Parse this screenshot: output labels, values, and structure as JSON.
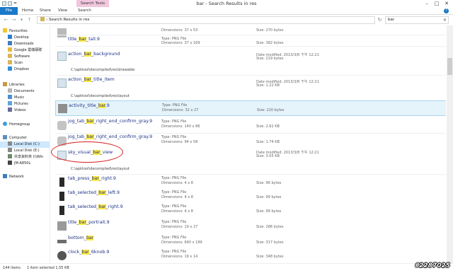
{
  "window": {
    "title": "bar - Search Results in res",
    "context_tab": "Search Tools",
    "qat_label": "="
  },
  "ribbon": {
    "tabs": [
      "File",
      "Home",
      "Share",
      "View",
      "Search"
    ]
  },
  "address": {
    "path": "Search Results in res",
    "search_value": "bar"
  },
  "nav": {
    "items": [
      {
        "label": "Favourites",
        "icon": "star-icon"
      },
      {
        "label": "Desktop",
        "icon": "desktop-icon"
      },
      {
        "label": "Downloads",
        "icon": "downloads-icon"
      },
      {
        "label": "Google 雲端硬碟",
        "icon": "drive-icon"
      },
      {
        "label": "Software",
        "icon": "folder-icon"
      },
      {
        "label": "Scan",
        "icon": "folder-icon"
      },
      {
        "label": "Dropbox",
        "icon": "dropbox-icon"
      },
      {
        "label": "Libraries",
        "icon": "libraries-icon"
      },
      {
        "label": "Documents",
        "icon": "documents-icon"
      },
      {
        "label": "Music",
        "icon": "music-icon"
      },
      {
        "label": "Pictures",
        "icon": "pictures-icon"
      },
      {
        "label": "Videos",
        "icon": "videos-icon"
      },
      {
        "label": "Homegroup",
        "icon": "homegroup-icon"
      },
      {
        "label": "Computer",
        "icon": "computer-icon"
      },
      {
        "label": "Local Disk (C:)",
        "icon": "disk-icon"
      },
      {
        "label": "Local Disk (E:)",
        "icon": "disk-icon"
      },
      {
        "label": "共享資料夾 (\\\\Win",
        "icon": "network-drive-icon"
      },
      {
        "label": "JM-A850L",
        "icon": "device-icon"
      },
      {
        "label": "Network",
        "icon": "network-icon"
      }
    ]
  },
  "results": [
    {
      "pre": "title_",
      "hl": "bar",
      "post": "_tall.9",
      "m1": "",
      "m2": "Dimensions: 37 x 53",
      "m3": "",
      "m4": "Size: 270 bytes",
      "path": ""
    },
    {
      "pre": "title_",
      "hl": "bar",
      "post": "_tall.9",
      "m1": "Type: PNG File",
      "m2": "Dimensions: 37 x 169",
      "m3": "",
      "m4": "Size: 382 bytes",
      "path": ""
    },
    {
      "pre": "action_",
      "hl": "bar",
      "post": "_background",
      "m1": "",
      "m2": "",
      "m3": "Date modified: 2013/3/8 下午 12:21",
      "m4": "Size: 219 bytes",
      "path": "C:\\apktool\\decompiled\\res\\drawable"
    },
    {
      "pre": "action_",
      "hl": "bar",
      "post": "_title_item",
      "m1": "",
      "m2": "",
      "m3": "Date modified: 2013/3/8 下午 12:21",
      "m4": "Size: 1.22 KB",
      "path": "C:\\apktool\\decompiled\\res\\layout"
    },
    {
      "pre": "activity_title_",
      "hl": "bar",
      "post": ".9",
      "m1": "Type: PNG File",
      "m2": "Dimensions: 32 x 27",
      "m3": "",
      "m4": "Size: 220 bytes",
      "path": ""
    },
    {
      "pre": "jog_tab_",
      "hl": "bar",
      "post": "_right_end_confirm_gray.9",
      "m1": "Type: PNG File",
      "m2": "Dimensions: 140 x 86",
      "m3": "",
      "m4": "Size: 2.62 KB",
      "path": ""
    },
    {
      "pre": "jog_tab_",
      "hl": "bar",
      "post": "_right_end_confirm_gray.9",
      "m1": "Type: PNG File",
      "m2": "Dimensions: 94 x 58",
      "m3": "",
      "m4": "Size: 1.74 KB",
      "path": ""
    },
    {
      "pre": "sky_visual_",
      "hl": "bar",
      "post": "_view",
      "m1": "",
      "m2": "",
      "m3": "Date modified: 2013/3/8 下午 12:21",
      "m4": "Size: 3.05 KB",
      "path": "C:\\apktool\\decompiled\\res\\layout"
    },
    {
      "pre": "tab_press_",
      "hl": "bar",
      "post": "_right.9",
      "m1": "Type: PNG File",
      "m2": "Dimensions: 4 x 8",
      "m3": "",
      "m4": "Size: 96 bytes",
      "path": ""
    },
    {
      "pre": "tab_selected_",
      "hl": "bar",
      "post": "_left.9",
      "m1": "Type: PNG File",
      "m2": "Dimensions: 4 x 8",
      "m3": "",
      "m4": "Size: 99 bytes",
      "path": ""
    },
    {
      "pre": "tab_selected_",
      "hl": "bar",
      "post": "_right.9",
      "m1": "Type: PNG File",
      "m2": "Dimensions: 4 x 8",
      "m3": "",
      "m4": "Size: 99 bytes",
      "path": ""
    },
    {
      "pre": "title_",
      "hl": "bar",
      "post": "_portrait.9",
      "m1": "Type: PNG File",
      "m2": "Dimensions: 19 x 27",
      "m3": "",
      "m4": "Size: 286 bytes",
      "path": ""
    },
    {
      "pre": "bottom_",
      "hl": "bar",
      "post": "",
      "m1": "Type: PNG File",
      "m2": "Dimensions: 640 x 189",
      "m3": "",
      "m4": "Size: 317 bytes",
      "path": ""
    },
    {
      "pre": "clock_",
      "hl": "bar",
      "post": "_6knob.9",
      "m1": "Type: PNG File",
      "m2": "Dimensions: 19 x 14",
      "m3": "",
      "m4": "Size: 348 bytes",
      "path": ""
    }
  ],
  "status": {
    "count": "144 items",
    "selection": "1 item selected  1.55 KB"
  },
  "watermark": "#2287025",
  "colors": {
    "accent": "#1979ca",
    "highlight": "#ffeb3b",
    "annotation": "#d81e1e"
  }
}
